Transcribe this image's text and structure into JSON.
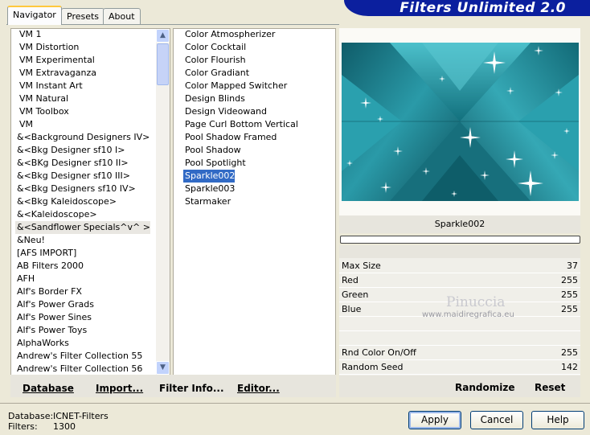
{
  "title": "Filters Unlimited 2.0",
  "tabs": [
    {
      "label": "Navigator"
    },
    {
      "label": "Presets"
    },
    {
      "label": "About"
    }
  ],
  "categories": [
    "VM 1",
    "VM Distortion",
    "VM Experimental",
    "VM Extravaganza",
    "VM Instant Art",
    "VM Natural",
    "VM Toolbox",
    "VM",
    "&<Background Designers IV>",
    "&<Bkg Designer sf10 I>",
    "&<BKg Designer sf10 II>",
    "&<Bkg Designer sf10 III>",
    "&<Bkg Designers sf10 IV>",
    "&<Bkg Kaleidoscope>",
    "&<Kaleidoscope>",
    "&<Sandflower Specials^v^ >",
    "&Neu!",
    "[AFS IMPORT]",
    "AB Filters 2000",
    "AFH",
    "Alf's Border FX",
    "Alf's Power Grads",
    "Alf's Power Sines",
    "Alf's Power Toys",
    "AlphaWorks",
    "Andrew's Filter Collection 55",
    "Andrew's Filter Collection 56"
  ],
  "filters": [
    "Color Atmospherizer",
    "Color Cocktail",
    "Color Flourish",
    "Color Gradiant",
    "Color Mapped Switcher",
    "Design Blinds",
    "Design Videowand",
    "Page Curl Bottom Vertical",
    "Pool Shadow Framed",
    "Pool Shadow",
    "Pool Spotlight",
    "Sparkle002",
    "Sparkle003",
    "Starmaker"
  ],
  "bottom_links": {
    "database": "Database",
    "import": "Import...",
    "filter_info": "Filter Info...",
    "editor": "Editor..."
  },
  "selected_filter": "Sparkle002",
  "parameters": [
    {
      "label": "Max Size",
      "value": "37"
    },
    {
      "label": "Red",
      "value": "255"
    },
    {
      "label": "Green",
      "value": "255"
    },
    {
      "label": "Blue",
      "value": "255"
    },
    {
      "label": "",
      "value": ""
    },
    {
      "label": "",
      "value": ""
    },
    {
      "label": "Rnd Color On/Off",
      "value": "255"
    },
    {
      "label": "Random Seed",
      "value": "142"
    }
  ],
  "param_buttons": {
    "randomize": "Randomize",
    "reset": "Reset"
  },
  "watermark": {
    "line1": "Pinuccia",
    "line2": "www.maidiregrafica.eu"
  },
  "status": {
    "database_label": "Database:",
    "database_value": "ICNET-Filters",
    "filters_label": "Filters:",
    "filters_value": "1300"
  },
  "dialog_buttons": {
    "apply": "Apply",
    "cancel": "Cancel",
    "help": "Help"
  },
  "colors": {
    "banner": "#0b1f9e",
    "preview_teal": "#1e8a99",
    "selection": "#316ac5"
  }
}
